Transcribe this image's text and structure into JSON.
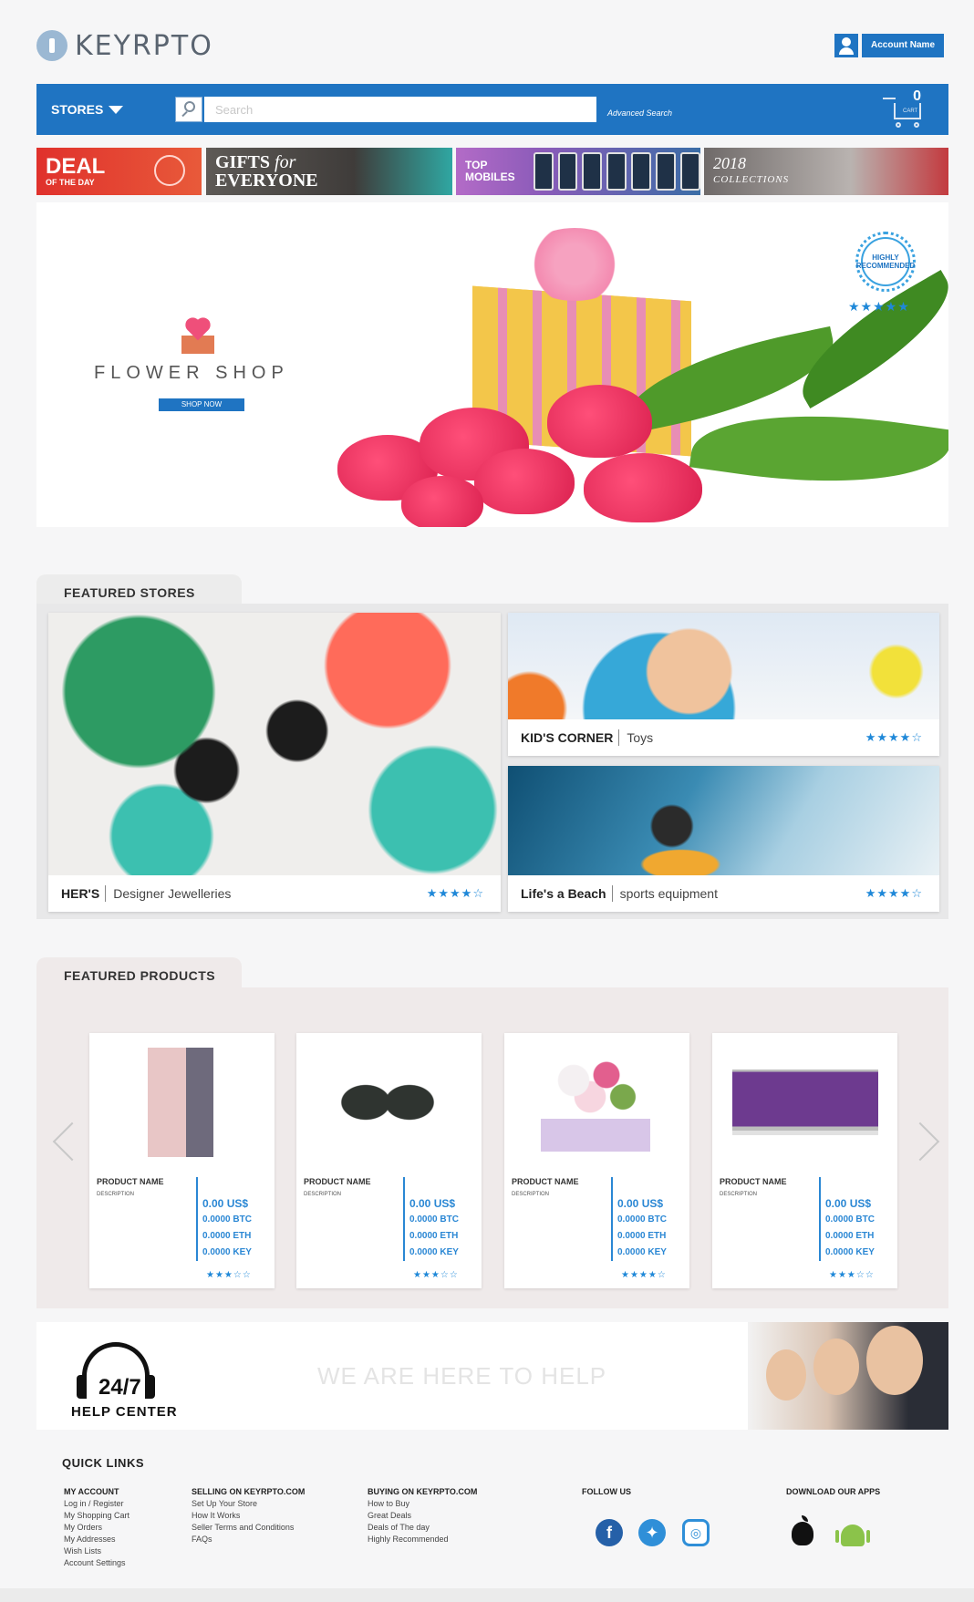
{
  "header": {
    "logo": "KEYRPTO",
    "account_label": "Account Name"
  },
  "navbar": {
    "stores_label": "STORES",
    "search_placeholder": "Search",
    "advanced_search": "Advanced Search",
    "cart_count": "0",
    "cart_label": "CART"
  },
  "promos": {
    "deal": {
      "title": "DEAL",
      "sub": "OF THE DAY"
    },
    "gifts": {
      "line1": "GIFTS",
      "line1_italic": "for",
      "line2": "EVERYONE"
    },
    "mobiles": {
      "line1": "TOP",
      "line2": "MOBILES"
    },
    "collections": {
      "year": "2018",
      "label": "COLLECTIONS"
    }
  },
  "hero": {
    "title": "FLOWER SHOP",
    "button": "SHOP NOW",
    "badge": "HIGHLY RECOMMENDED",
    "stars": "★★★★★"
  },
  "featured_stores": {
    "title": "FEATURED STORES",
    "stores": [
      {
        "name": "HER'S",
        "category": "Designer Jewelleries",
        "rating": 4
      },
      {
        "name": "KID'S CORNER",
        "category": "Toys",
        "rating": 4
      },
      {
        "name": "Life's a Beach",
        "category": "sports equipment",
        "rating": 4
      }
    ]
  },
  "featured_products": {
    "title": "FEATURED PRODUCTS",
    "products": [
      {
        "name": "PRODUCT NAME",
        "description": "DESCRIPTION",
        "usd": "0.00 US$",
        "btc": "0.0000 BTC",
        "eth": "0.0000 ETH",
        "key": "0.0000 KEY",
        "rating": 3
      },
      {
        "name": "PRODUCT NAME",
        "description": "DESCRIPTION",
        "usd": "0.00 US$",
        "btc": "0.0000 BTC",
        "eth": "0.0000 ETH",
        "key": "0.0000 KEY",
        "rating": 3
      },
      {
        "name": "PRODUCT NAME",
        "description": "DESCRIPTION",
        "usd": "0.00 US$",
        "btc": "0.0000 BTC",
        "eth": "0.0000 ETH",
        "key": "0.0000 KEY",
        "rating": 4
      },
      {
        "name": "PRODUCT NAME",
        "description": "DESCRIPTION",
        "usd": "0.00 US$",
        "btc": "0.0000 BTC",
        "eth": "0.0000 ETH",
        "key": "0.0000 KEY",
        "rating": 3
      }
    ]
  },
  "help": {
    "hours": "24/7",
    "label": "HELP CENTER",
    "tagline": "WE ARE HERE TO HELP"
  },
  "footer": {
    "title": "QUICK LINKS",
    "my_account": {
      "heading": "MY ACCOUNT",
      "links": [
        "Log in / Register",
        "My Shopping Cart",
        "My Orders",
        "My Addresses",
        "Wish Lists",
        "Account Settings"
      ]
    },
    "selling": {
      "heading": "SELLING ON KEYRPTO.COM",
      "links": [
        "Set Up Your Store",
        "How It Works",
        "Seller Terms and Conditions",
        "FAQs"
      ]
    },
    "buying": {
      "heading": "BUYING ON KEYRPTO.COM",
      "links": [
        "How to Buy",
        "Great Deals",
        "Deals of The day",
        "Highly Recommended"
      ]
    },
    "follow": {
      "heading": "FOLLOW US"
    },
    "apps": {
      "heading": "DOWNLOAD OUR APPS"
    }
  },
  "colors": {
    "brand_blue": "#1f74c2",
    "star_blue": "#1f88d8"
  }
}
